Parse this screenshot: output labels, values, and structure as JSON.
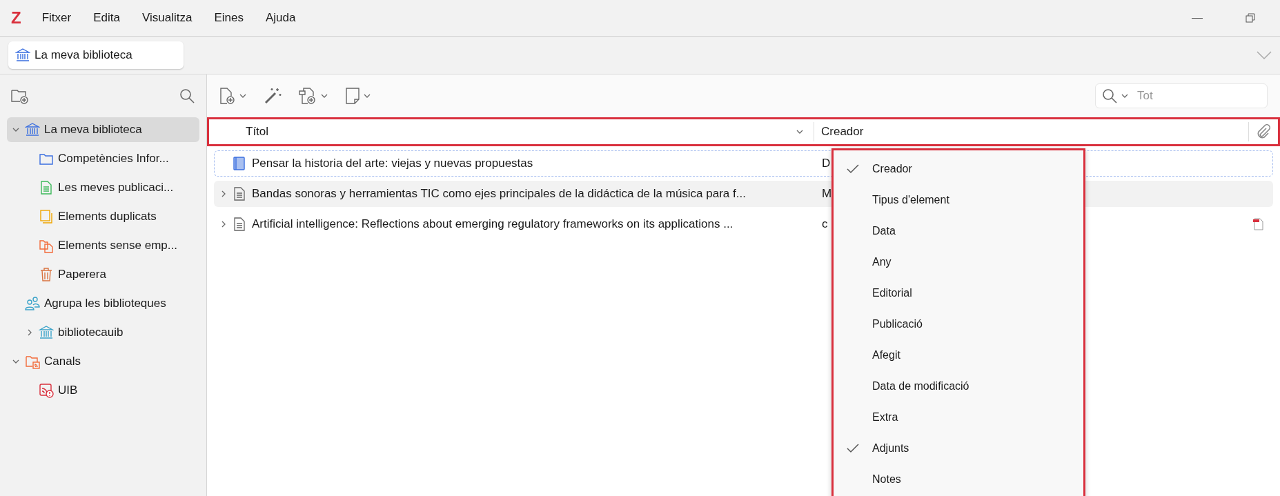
{
  "app_logo": "Z",
  "menu_bar": [
    "Fitxer",
    "Edita",
    "Visualitza",
    "Eines",
    "Ajuda"
  ],
  "tabs": [
    {
      "label": "La meva biblioteca",
      "selected": true
    }
  ],
  "sidebar": {
    "tree": [
      {
        "label": "La meva biblioteca",
        "kind": "library",
        "selected": true,
        "expanded": true,
        "children": [
          {
            "label": "Competències Infor...",
            "kind": "folder",
            "selected": false
          },
          {
            "label": "Les meves publicaci...",
            "kind": "publications",
            "selected": false
          },
          {
            "label": "Elements duplicats",
            "kind": "duplicates",
            "selected": false
          },
          {
            "label": "Elements sense emp...",
            "kind": "unfiled",
            "selected": false
          },
          {
            "label": "Paperera",
            "kind": "trash",
            "selected": false
          }
        ]
      },
      {
        "label": "Agrupa les biblioteques",
        "kind": "groups",
        "selected": false,
        "children": [
          {
            "label": "bibliotecauib",
            "kind": "group-library",
            "selected": false,
            "expanded": false
          }
        ]
      },
      {
        "label": "Canals",
        "kind": "feeds",
        "selected": false,
        "expanded": true,
        "children": [
          {
            "label": "UIB",
            "kind": "feed-error",
            "selected": false
          }
        ]
      }
    ]
  },
  "search": {
    "placeholder": "Tot"
  },
  "table": {
    "columns": [
      "Títol",
      "Creador"
    ],
    "rows": [
      {
        "title": "Pensar la historia del arte: viejas y nuevas propuestas",
        "creator": "D",
        "kind": "book",
        "focused": true,
        "hovered": false,
        "attachment": false
      },
      {
        "title": "Bandas sonoras y herramientas TIC como ejes principales de la didáctica de la música para f...",
        "creator": "M",
        "kind": "document",
        "expanded": false,
        "focused": false,
        "hovered": true,
        "attachment": false
      },
      {
        "title": "Artificial intelligence: Reflections about emerging regulatory frameworks on its applications ...",
        "creator": "c",
        "kind": "document",
        "expanded": false,
        "focused": false,
        "hovered": false,
        "attachment": true
      }
    ]
  },
  "column_menu": [
    {
      "label": "Creador",
      "checked": true
    },
    {
      "label": "Tipus d'element",
      "checked": false
    },
    {
      "label": "Data",
      "checked": false
    },
    {
      "label": "Any",
      "checked": false
    },
    {
      "label": "Editorial",
      "checked": false
    },
    {
      "label": "Publicació",
      "checked": false
    },
    {
      "label": "Afegit",
      "checked": false
    },
    {
      "label": "Data de modificació",
      "checked": false
    },
    {
      "label": "Extra",
      "checked": false
    },
    {
      "label": "Adjunts",
      "checked": true
    },
    {
      "label": "Notes",
      "checked": false
    }
  ]
}
